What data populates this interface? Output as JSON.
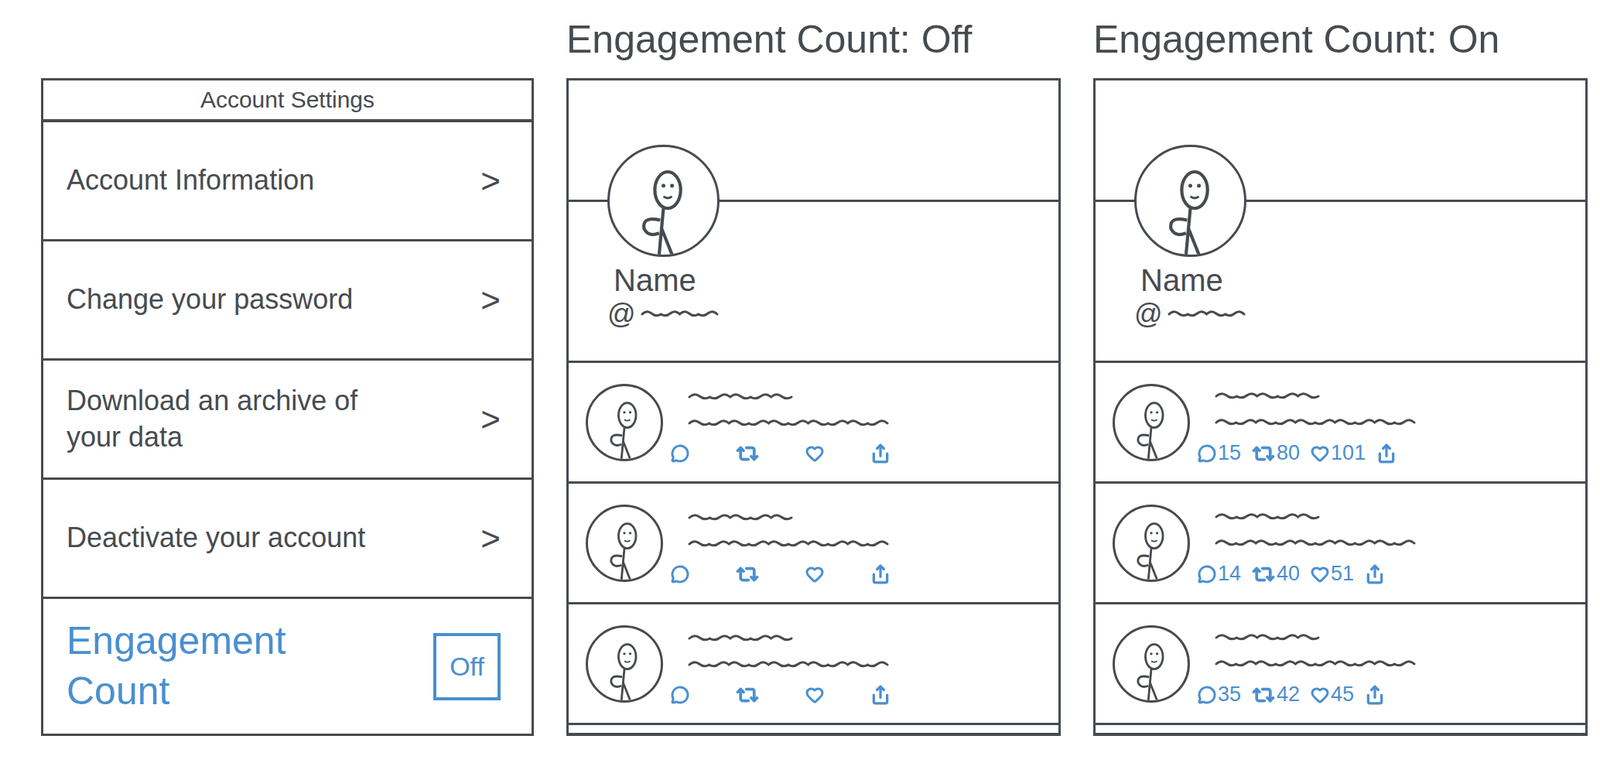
{
  "settings": {
    "title": "Account Settings",
    "items": [
      {
        "label": "Account Information",
        "kind": "link",
        "chevron": ">"
      },
      {
        "label": "Change your password",
        "kind": "link",
        "chevron": ">"
      },
      {
        "label": "Download an archive of your data",
        "kind": "link",
        "chevron": ">"
      },
      {
        "label": "Deactivate your account",
        "kind": "link",
        "chevron": ">"
      },
      {
        "label": "Engagement Count",
        "kind": "toggle",
        "value": "Off",
        "on": false
      }
    ]
  },
  "previews": [
    {
      "title": "Engagement Count: Off",
      "on": false,
      "profile": {
        "name": "Name",
        "handle": "@"
      },
      "posts": [
        {},
        {},
        {}
      ]
    },
    {
      "title": "Engagement Count: On",
      "on": true,
      "profile": {
        "name": "Name",
        "handle": "@"
      },
      "posts": [
        {
          "reply": "15",
          "retweet": "80",
          "like": "101"
        },
        {
          "reply": "14",
          "retweet": "40",
          "like": "51"
        },
        {
          "reply": "35",
          "retweet": "42",
          "like": "45"
        }
      ]
    }
  ]
}
